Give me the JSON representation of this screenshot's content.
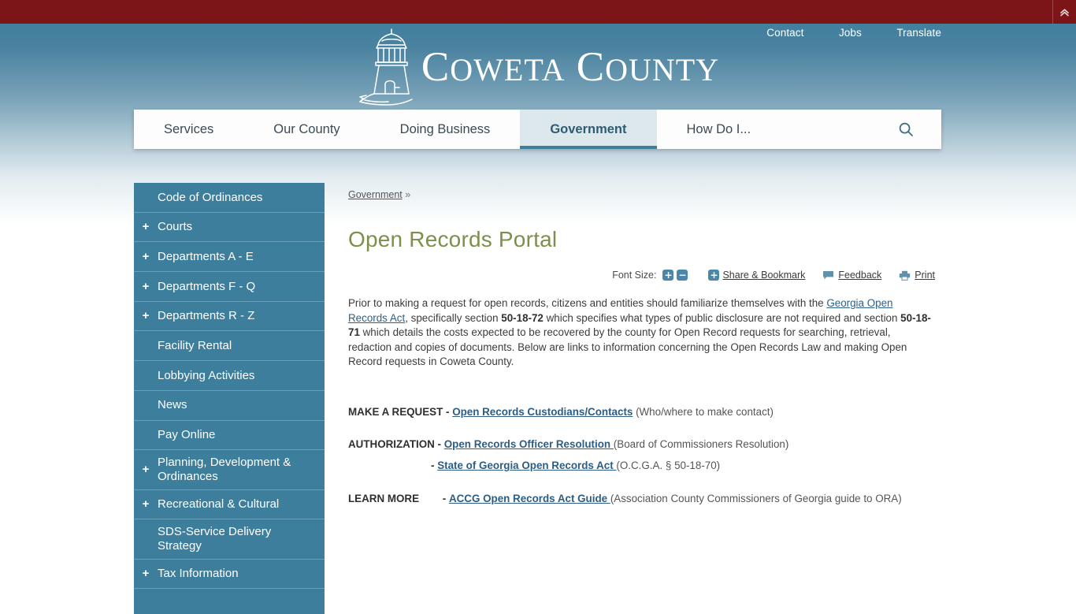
{
  "topbar": {
    "collapse_icon": "double-chevron-up-icon"
  },
  "utility_nav": [
    {
      "label": "Contact"
    },
    {
      "label": "Jobs"
    },
    {
      "label": "Translate"
    }
  ],
  "branding": {
    "logo_icon": "lighthouse-logo",
    "title_part1_cap": "C",
    "title_part1_rest": "OWETA",
    "title_part2_cap": "C",
    "title_part2_rest": "OUNTY",
    "title_full": "Coweta County"
  },
  "main_nav": {
    "items": [
      {
        "label": "Services",
        "active": false
      },
      {
        "label": "Our County",
        "active": false
      },
      {
        "label": "Doing Business",
        "active": false
      },
      {
        "label": "Government",
        "active": true
      },
      {
        "label": "How Do I...",
        "active": false
      }
    ],
    "search_icon": "search-icon"
  },
  "sidebar": {
    "items": [
      {
        "label": "Code of Ordinances",
        "expandable": false
      },
      {
        "label": "Courts",
        "expandable": true,
        "toggle": "+"
      },
      {
        "label": "Departments A - E",
        "expandable": true,
        "toggle": "+"
      },
      {
        "label": "Departments F - Q",
        "expandable": true,
        "toggle": "+"
      },
      {
        "label": "Departments R - Z",
        "expandable": true,
        "toggle": "+"
      },
      {
        "label": "Facility Rental",
        "expandable": false
      },
      {
        "label": "Lobbying Activities",
        "expandable": false
      },
      {
        "label": "News",
        "expandable": false
      },
      {
        "label": "Pay Online",
        "expandable": false
      },
      {
        "label": "Planning, Development & Ordinances",
        "expandable": true,
        "toggle": "+"
      },
      {
        "label": "Recreational & Cultural",
        "expandable": true,
        "toggle": "+"
      },
      {
        "label": "SDS-Service Delivery Strategy",
        "expandable": false
      },
      {
        "label": "Tax Information",
        "expandable": true,
        "toggle": "+"
      },
      {
        "label": "",
        "expandable": false
      }
    ]
  },
  "breadcrumb": {
    "parent": "Government",
    "separator": "»"
  },
  "page": {
    "title": "Open Records Portal"
  },
  "toolbar": {
    "font_size_label": "Font Size:",
    "increase_icon": "plus-icon",
    "increase_symbol": "+",
    "decrease_icon": "minus-icon",
    "decrease_symbol": "−",
    "share_icon": "plus-icon",
    "share_symbol": "+",
    "share_label": "Share & Bookmark",
    "feedback_icon": "speech-bubble-icon",
    "feedback_label": "Feedback",
    "print_icon": "printer-icon",
    "print_label": "Print"
  },
  "body": {
    "p1_a": "Prior to making a request for open records, citizens and entities should familiarize themselves with the ",
    "p1_link": "Georgia Open Records Act",
    "p1_b": ", specifically section ",
    "p1_bold1": "50-18-72",
    "p1_c": " which specifies what types of public disclosure are not required and section ",
    "p1_bold2": "50-18-71",
    "p1_d": " which details the costs expected to be recovered by the county for Open Record requests for searching, retrieval, redaction and copies of documents. Below are links to information concerning the Open Records Law and making Open Record requests in Coweta County."
  },
  "links": {
    "make_request": {
      "tag": "MAKE A REQUEST -",
      "link": "Open Records Custodians/Contacts",
      "note": " (Who/where to make contact)"
    },
    "authorization": {
      "tag": "AUTHORIZATION -",
      "link": "Open Records Officer Resolution ",
      "note": " (Board of Commissioners Resolution)"
    },
    "authorization_sub": {
      "tag": "-",
      "link": "State of Georgia Open Records Act ",
      "note": " (O.C.G.A. § 50-18-70)"
    },
    "learn_more": {
      "tag": "LEARN MORE",
      "dash": "-",
      "link": "ACCG Open Records Act Guide ",
      "note": " (Association County Commissioners of Georgia guide to ORA)"
    }
  },
  "colors": {
    "red_bar": "#7c1517",
    "teal": "#3d7e9d",
    "title_green": "#7d9049",
    "link_blue": "#2e5f86"
  }
}
